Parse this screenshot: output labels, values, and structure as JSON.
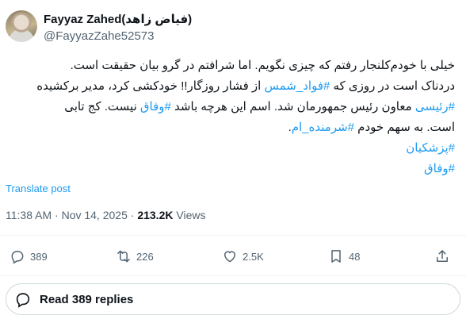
{
  "author": {
    "name": "Fayyaz Zahed(فیاض زاهد)",
    "handle": "@FayyazZahe52573"
  },
  "post": {
    "lines": [
      [
        {
          "t": "خیلی با خودم‌کلنجار رفتم که چیزی نگویم. اما شرافتم در گرو بیان حقیقت است."
        }
      ],
      [
        {
          "t": "دردناک است در روزی که "
        },
        {
          "t": "#فواد_شمس",
          "tag": true
        },
        {
          "t": " از فشار روزگار!! خودکشی کرد، مدیر برکشیده"
        }
      ],
      [
        {
          "t": "#رئیسی",
          "tag": true
        },
        {
          "t": " معاون رئیس جمهورمان شد. اسم این هرچه باشد "
        },
        {
          "t": "#وفاق",
          "tag": true
        },
        {
          "t": " نیست. کج تابی"
        }
      ],
      [
        {
          "t": "است. به سهم خودم "
        },
        {
          "t": "#شرمنده_ام",
          "tag": true
        },
        {
          "t": "."
        }
      ],
      [
        {
          "t": "#پزشکیان",
          "tag": true
        }
      ],
      [
        {
          "t": "#وفاق",
          "tag": true
        }
      ]
    ],
    "translate_label": "Translate post",
    "time": "11:38 AM",
    "date": "Nov 14, 2025",
    "views_count": "213.2K",
    "views_label": "Views"
  },
  "actions": {
    "replies": "389",
    "reposts": "226",
    "likes": "2.5K",
    "bookmarks": "48"
  },
  "read_replies_label": "Read 389 replies",
  "colors": {
    "accent": "#1d9bf0",
    "muted": "#536471",
    "text": "#0f1419",
    "divider": "#eff3f4"
  }
}
